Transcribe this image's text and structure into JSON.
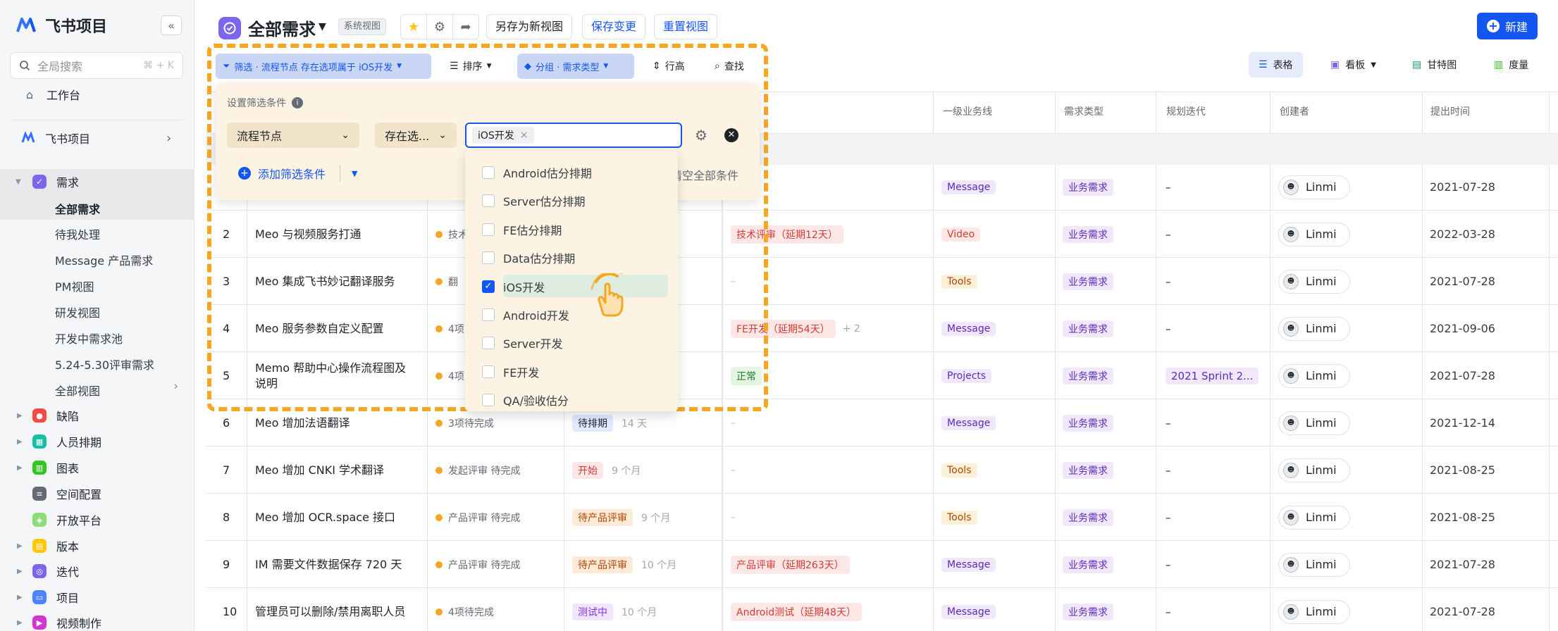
{
  "sidebar": {
    "app_name": "飞书项目",
    "collapse": "«",
    "search_placeholder": "全局搜索",
    "search_shortcut": "⌘ + K",
    "workbench": "工作台",
    "space_name": "飞书项目",
    "req_section": "需求",
    "req_views": [
      "全部需求",
      "待我处理",
      "Message 产品需求",
      "PM视图",
      "研发视图",
      "开发中需求池",
      "5.24-5.30评审需求",
      "全部视图"
    ],
    "sections": [
      "缺陷",
      "人员排期",
      "图表",
      "空间配置",
      "开放平台",
      "版本",
      "迭代",
      "项目",
      "视频制作"
    ]
  },
  "header": {
    "title": "全部需求",
    "badge": "系统视图",
    "save_as": "另存为新视图",
    "save_changes": "保存变更",
    "reset_view": "重置视图",
    "new_button": "新建",
    "colors": {
      "accent": "#1456f0",
      "brand": "#7b67ee"
    }
  },
  "toolbar": {
    "filter": "筛选 · 流程节点 存在选项属于 iOS开发",
    "sort": "排序",
    "group": "分组 · 需求类型",
    "row_height": "行高",
    "find": "查找"
  },
  "views": [
    "表格",
    "看板",
    "甘特图",
    "度量"
  ],
  "filter_panel": {
    "title": "设置筛选条件",
    "field": "流程节点",
    "operator": "存在选...",
    "chip": "iOS开发",
    "add": "添加筛选条件",
    "clear": "清空全部条件",
    "options": [
      "Android估分排期",
      "Server估分排期",
      "FE估分排期",
      "Data估分排期",
      "iOS开发",
      "Android开发",
      "Server开发",
      "FE开发",
      "QA/验收估分"
    ],
    "checked": "iOS开发"
  },
  "table": {
    "headers": [
      "一级业务线",
      "需求类型",
      "规划迭代",
      "创建者",
      "提出时间"
    ],
    "rows": [
      {
        "num": "",
        "title": "",
        "progress": "",
        "stage": "",
        "age": "",
        "warn": "",
        "biz": "Message",
        "type": "业务需求",
        "iter": "–",
        "creator": "Linmi",
        "date": "2021-07-28"
      },
      {
        "num": "2",
        "title": "Meo 与视频服务打通",
        "progress": "技术",
        "stage": "",
        "age": "",
        "warn": "技术评审（延期12天）",
        "biz": "Video",
        "type": "业务需求",
        "iter": "–",
        "creator": "Linmi",
        "date": "2022-03-28"
      },
      {
        "num": "3",
        "title": "Meo 集成飞书妙记翻译服务",
        "progress": "翻",
        "stage": "",
        "age": "",
        "warn": "–",
        "biz": "Tools",
        "type": "业务需求",
        "iter": "–",
        "creator": "Linmi",
        "date": "2021-07-28"
      },
      {
        "num": "4",
        "title": "Meo 服务参数自定义配置",
        "progress": "4项",
        "stage": "",
        "age": "",
        "warn": "FE开发（延期54天）",
        "warn_extra": "+ 2",
        "biz": "Message",
        "type": "业务需求",
        "iter": "–",
        "creator": "Linmi",
        "date": "2021-09-06"
      },
      {
        "num": "5",
        "title": "Memo 帮助中心操作流程图及说明",
        "progress": "4项",
        "stage": "",
        "age": "",
        "warn": "正常",
        "biz": "Projects",
        "type": "业务需求",
        "iter": "2021 Sprint 2...",
        "creator": "Linmi",
        "date": "2021-07-28"
      },
      {
        "num": "6",
        "title": "Meo 增加法语翻译",
        "progress": "3项待完成",
        "stage": "待排期",
        "age": "14 天",
        "warn": "–",
        "biz": "Message",
        "type": "业务需求",
        "iter": "–",
        "creator": "Linmi",
        "date": "2021-12-14"
      },
      {
        "num": "7",
        "title": "Meo 增加 CNKI 学术翻译",
        "progress": "发起评审 待完成",
        "stage": "开始",
        "age": "9 个月",
        "warn": "–",
        "biz": "Tools",
        "type": "业务需求",
        "iter": "–",
        "creator": "Linmi",
        "date": "2021-08-25"
      },
      {
        "num": "8",
        "title": "Meo 增加 OCR.space 接口",
        "progress": "产品评审 待完成",
        "stage": "待产品评审",
        "age": "9 个月",
        "warn": "–",
        "biz": "Tools",
        "type": "业务需求",
        "iter": "–",
        "creator": "Linmi",
        "date": "2021-08-25"
      },
      {
        "num": "9",
        "title": "IM 需要文件数据保存 720 天",
        "progress": "产品评审 待完成",
        "stage": "待产品评审",
        "age": "10 个月",
        "warn": "产品评审（延期263天）",
        "biz": "Message",
        "type": "业务需求",
        "iter": "–",
        "creator": "Linmi",
        "date": "2021-07-28"
      },
      {
        "num": "10",
        "title": "管理员可以删除/禁用离职人员",
        "progress": "4项待完成",
        "stage": "测试中",
        "age": "10 个月",
        "warn": "Android测试（延期48天）",
        "biz": "Message",
        "type": "业务需求",
        "iter": "–",
        "creator": "Linmi",
        "date": "2021-07-28"
      }
    ]
  }
}
